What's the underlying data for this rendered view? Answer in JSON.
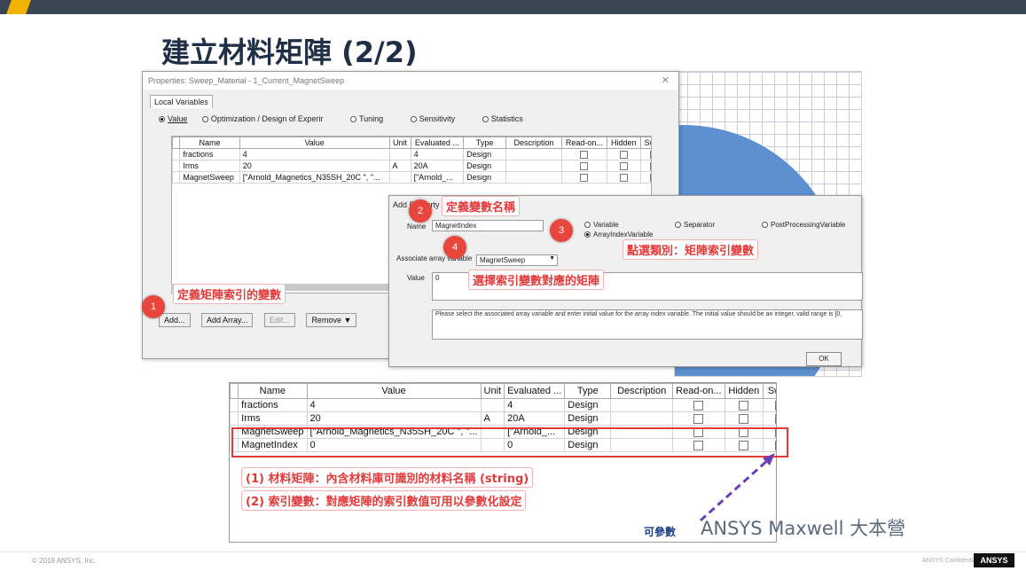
{
  "slide": {
    "title": "建立材料矩陣 (2/2)"
  },
  "props_window": {
    "title": "Properties: Sweep_Material - 1_Current_MagnetSweep",
    "close": "✕",
    "tab": "Local Variables",
    "radios": [
      "Value",
      "Optimization / Design of Experir",
      "Tuning",
      "Sensitivity",
      "Statistics"
    ],
    "columns": [
      "Name",
      "Value",
      "Unit",
      "Evaluated ...",
      "Type",
      "Description",
      "Read-on...",
      "Hidden",
      "Swee"
    ],
    "rows": [
      {
        "name": "fractions",
        "value": "4",
        "unit": "",
        "evaluated": "4",
        "type": "Design",
        "sweep": true
      },
      {
        "name": "Irms",
        "value": "20",
        "unit": "A",
        "evaluated": "20A",
        "type": "Design",
        "sweep": true
      },
      {
        "name": "MagnetSweep",
        "value": "[\"Arnold_Magnetics_N35SH_20C \", \"...",
        "unit": "",
        "evaluated": "[\"Arnold_...",
        "type": "Design",
        "sweep": false
      }
    ],
    "buttons": {
      "add": "Add...",
      "add_array": "Add Array...",
      "edit": "Edit...",
      "remove": "Remove ▼"
    }
  },
  "add_dialog": {
    "title": "Add Property",
    "name_label": "Name",
    "name_value": "MagnetIndex",
    "radio_variable": "Variable",
    "radio_separator": "Separator",
    "radio_postproc": "PostProcessingVariable",
    "radio_arrayindex": "ArrayIndexVariable",
    "assoc_label": "Associate array variable",
    "assoc_value": "MagnetSweep",
    "value_label": "Value",
    "value_value": "0",
    "help": "Please select the associated array variable and enter initial value for the array index variable.  The initial value should be an integer, valid range is [0,",
    "ok": "OK"
  },
  "big_table": {
    "columns": [
      "Name",
      "Value",
      "Unit",
      "Evaluated ...",
      "Type",
      "Description",
      "Read-on...",
      "Hidden",
      "Swee"
    ],
    "rows": [
      {
        "name": "fractions",
        "value": "4",
        "unit": "",
        "evaluated": "4",
        "type": "Design",
        "sweep": true
      },
      {
        "name": "Irms",
        "value": "20",
        "unit": "A",
        "evaluated": "20A",
        "type": "Design",
        "sweep": true
      },
      {
        "name": "MagnetSweep",
        "value": "[\"Arnold_Magnetics_N35SH_20C \", \"...",
        "unit": "",
        "evaluated": "[\"Arnold_...",
        "type": "Design",
        "sweep": false
      },
      {
        "name": "MagnetIndex",
        "value": "0",
        "unit": "",
        "evaluated": "0",
        "type": "Design",
        "sweep": true
      }
    ]
  },
  "annotations": {
    "n1": "1",
    "t1": "定義矩陣索引的變數",
    "n2": "2",
    "t2": "定義變數名稱",
    "n3": "3",
    "t3": "點選類別：矩陣索引變數",
    "n4": "4",
    "t4": "選擇索引變數對應的矩陣",
    "note1": "(1) 材料矩陣：內含材料庫可識別的材料名稱 (string)",
    "note2": "(2) 索引變數：對應矩陣的索引數值可用以參數化設定",
    "param": "可參數",
    "watermark": "ANSYS Maxwell 大本營"
  },
  "footer": {
    "copyright": "© 2019 ANSYS, Inc.",
    "confidential": "ANSYS Confidential",
    "logo": "ANSYS"
  },
  "colors": {
    "accent": "#f2b300",
    "annotation_red": "#e03b3b",
    "topbar": "#3a4652"
  }
}
